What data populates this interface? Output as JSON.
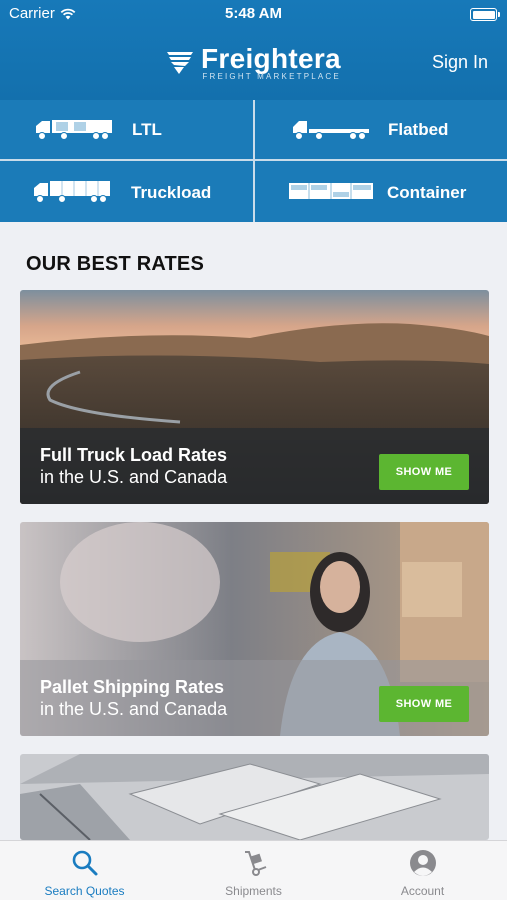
{
  "status_bar": {
    "carrier": "Carrier",
    "time": "5:48 AM"
  },
  "header": {
    "brand_name": "Freightera",
    "brand_tagline": "FREIGHT MARKETPLACE",
    "sign_in_label": "Sign In"
  },
  "modes": [
    {
      "label": "LTL",
      "icon": "ltl-truck-icon"
    },
    {
      "label": "Flatbed",
      "icon": "flatbed-truck-icon"
    },
    {
      "label": "Truckload",
      "icon": "truckload-truck-icon"
    },
    {
      "label": "Container",
      "icon": "container-icon"
    }
  ],
  "section_title": "OUR BEST RATES",
  "cards": [
    {
      "title": "Full Truck Load Rates",
      "subtitle": "in the U.S. and Canada",
      "button": "SHOW ME"
    },
    {
      "title": "Pallet Shipping Rates",
      "subtitle": "in the U.S. and Canada",
      "button": "SHOW ME"
    },
    {
      "title": "",
      "subtitle": "",
      "button": ""
    }
  ],
  "tabbar": [
    {
      "label": "Search Quotes",
      "icon": "search-icon",
      "active": true
    },
    {
      "label": "Shipments",
      "icon": "hand-truck-icon",
      "active": false
    },
    {
      "label": "Account",
      "icon": "person-icon",
      "active": false
    }
  ],
  "colors": {
    "header_blue": "#1779b9",
    "accent_green": "#5cb631",
    "active_tab": "#1a7cc0"
  }
}
